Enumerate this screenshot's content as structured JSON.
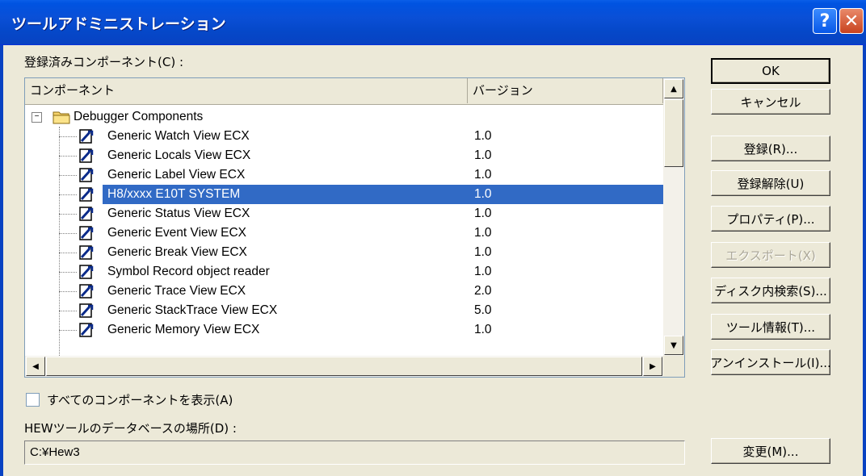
{
  "window": {
    "title": "ツールアドミニストレーション",
    "help_glyph": "?",
    "close_glyph": "✕"
  },
  "registered_label": "登録済みコンポーネント(C) :",
  "columns": [
    "コンポーネント",
    "バージョン"
  ],
  "group": {
    "label": "Debugger Components",
    "expander": "−"
  },
  "rows": [
    {
      "name": "Generic Watch View ECX",
      "version": "1.0"
    },
    {
      "name": "Generic Locals View ECX",
      "version": "1.0"
    },
    {
      "name": "Generic Label View ECX",
      "version": "1.0"
    },
    {
      "name": "H8/xxxx E10T SYSTEM",
      "version": "1.0",
      "selected": true
    },
    {
      "name": "Generic Status View ECX",
      "version": "1.0"
    },
    {
      "name": "Generic Event View ECX",
      "version": "1.0"
    },
    {
      "name": "Generic Break View ECX",
      "version": "1.0"
    },
    {
      "name": "Symbol Record object reader",
      "version": "1.0"
    },
    {
      "name": "Generic Trace View ECX",
      "version": "2.0"
    },
    {
      "name": "Generic StackTrace View ECX",
      "version": "5.0"
    },
    {
      "name": "Generic Memory View ECX",
      "version": "1.0"
    }
  ],
  "buttons": {
    "ok": "OK",
    "cancel": "キャンセル",
    "register": "登録(R)...",
    "unregister": "登録解除(U)",
    "properties": "プロパティ(P)...",
    "export": "エクスポート(X)",
    "search_disk": "ディスク内検索(S)...",
    "tool_info": "ツール情報(T)...",
    "uninstall": "アンインストール(I)...",
    "change": "変更(M)..."
  },
  "show_all_label": "すべてのコンポーネントを表示(A)",
  "show_all_checked": false,
  "db_location_label": "HEWツールのデータベースの場所(D) :",
  "db_location_value": "C:¥Hew3",
  "colors": {
    "title_bar": "#0842c2",
    "selection": "#316ac5",
    "dialog_bg": "#ece9d8"
  }
}
